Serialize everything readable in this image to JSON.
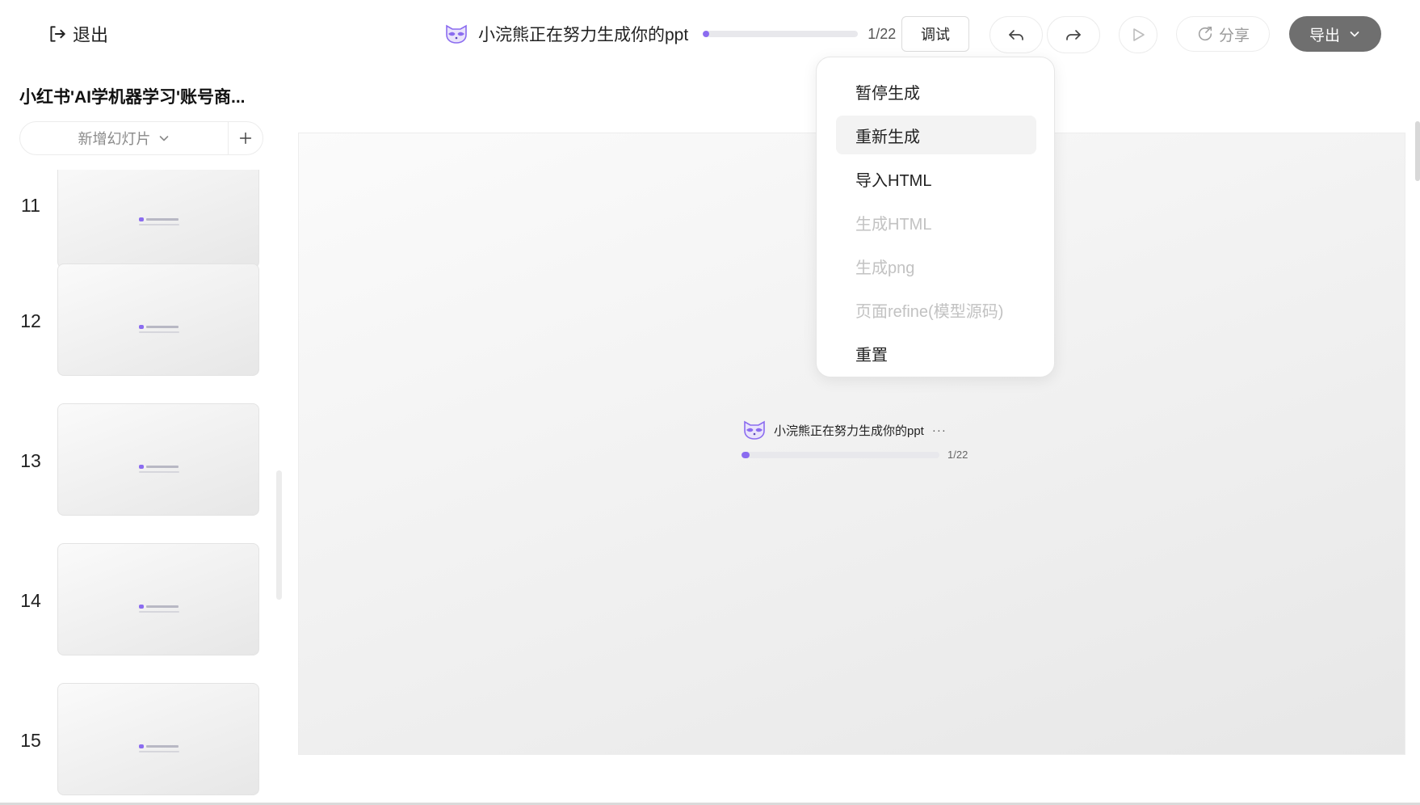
{
  "header": {
    "exit_label": "退出",
    "gen_status_text": "小浣熊正在努力生成你的ppt",
    "progress_count": "1/22",
    "progress_fraction": 0.04,
    "debug_label": "调试",
    "share_label": "分享",
    "export_label": "导出"
  },
  "sidebar": {
    "doc_title": "小红书'AI学机器学习'账号商...",
    "add_slide_label": "新增幻灯片",
    "slides": [
      {
        "number": "11"
      },
      {
        "number": "12"
      },
      {
        "number": "13"
      },
      {
        "number": "14"
      },
      {
        "number": "15"
      }
    ]
  },
  "canvas": {
    "status_text": "小浣熊正在努力生成你的ppt",
    "dots": "···",
    "progress_count": "1/22",
    "progress_fraction": 0.04
  },
  "dropdown": {
    "items": [
      {
        "label": "暂停生成",
        "state": "normal"
      },
      {
        "label": "重新生成",
        "state": "active"
      },
      {
        "label": "导入HTML",
        "state": "normal"
      },
      {
        "label": "生成HTML",
        "state": "disabled"
      },
      {
        "label": "生成png",
        "state": "disabled"
      },
      {
        "label": "页面refine(模型源码)",
        "state": "disabled"
      },
      {
        "label": "重置",
        "state": "normal"
      }
    ]
  },
  "colors": {
    "accent": "#8b6cf0",
    "export_bg": "#6f6f6f",
    "disabled_text": "#c2c2c2"
  },
  "icons": {
    "exit": "exit-icon",
    "mascot": "raccoon-icon",
    "undo": "undo-icon",
    "redo": "redo-icon",
    "play": "play-icon",
    "share": "share-icon",
    "export_chevron": "chevron-down-icon",
    "add_slide_chevron": "chevron-down-icon",
    "add": "plus-icon"
  }
}
